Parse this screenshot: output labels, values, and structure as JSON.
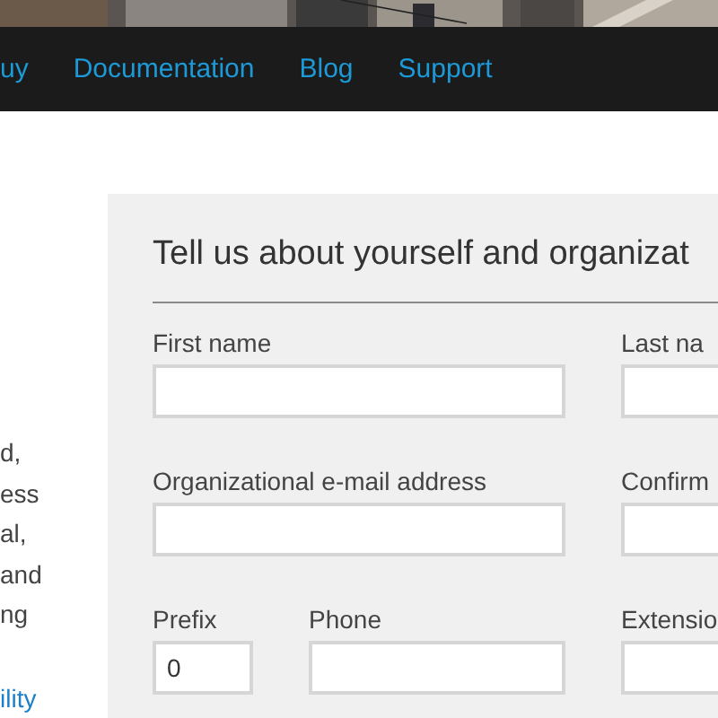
{
  "nav": {
    "items": [
      {
        "label": "uy"
      },
      {
        "label": "Documentation"
      },
      {
        "label": "Blog"
      },
      {
        "label": "Support"
      }
    ]
  },
  "intro": {
    "lines": [
      "d,",
      "ess",
      "al,",
      "and",
      "ng"
    ],
    "link": "ility"
  },
  "form": {
    "heading": "Tell us about yourself and organizat",
    "rows": [
      {
        "fields": [
          {
            "label": "First name",
            "kind": "wide"
          },
          {
            "label": "Last na",
            "kind": "wide"
          }
        ]
      },
      {
        "fields": [
          {
            "label": "Organizational e-mail address",
            "kind": "wide"
          },
          {
            "label": "Confirm",
            "kind": "wide"
          }
        ]
      },
      {
        "fields": [
          {
            "label": "Prefix",
            "kind": "tiny",
            "value": "0"
          },
          {
            "label": "Phone",
            "kind": "medium"
          },
          {
            "label": "Extensio",
            "kind": "wide"
          }
        ]
      }
    ]
  }
}
